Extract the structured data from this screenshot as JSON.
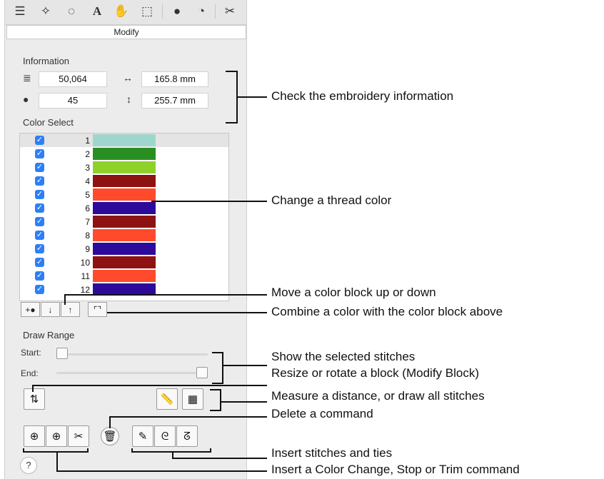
{
  "toolbar": {
    "icons": [
      "layers-icon",
      "sparkle-icon",
      "dotted-circle-icon",
      "text-icon",
      "palette-hand-icon",
      "frame-icon",
      "filled-circle-icon",
      "clock-icon",
      "scissors-icon"
    ],
    "glyphs": [
      "☰",
      "✧",
      "◌",
      "A",
      "✋",
      "⬚",
      "●",
      "◔",
      "✂"
    ]
  },
  "tab": {
    "label": "Modify"
  },
  "information": {
    "heading": "Information",
    "stitch_count": "50,064",
    "width": "165.8 mm",
    "color_count": "45",
    "height": "255.7 mm"
  },
  "color_select": {
    "heading": "Color Select",
    "rows": [
      {
        "num": "1",
        "color": "#9ed6cd"
      },
      {
        "num": "2",
        "color": "#2a8f22"
      },
      {
        "num": "3",
        "color": "#8fd12a"
      },
      {
        "num": "4",
        "color": "#8e1212"
      },
      {
        "num": "5",
        "color": "#ff4b2b"
      },
      {
        "num": "6",
        "color": "#2e0a9a"
      },
      {
        "num": "7",
        "color": "#8e1212"
      },
      {
        "num": "8",
        "color": "#ff4b2b"
      },
      {
        "num": "9",
        "color": "#2e0a9a"
      },
      {
        "num": "10",
        "color": "#8e1212"
      },
      {
        "num": "11",
        "color": "#ff4b2b"
      },
      {
        "num": "12",
        "color": "#2e0a9a"
      }
    ],
    "controls": [
      "+●",
      "↓",
      "↑",
      "⌜⌝"
    ]
  },
  "draw_range": {
    "heading": "Draw Range",
    "start_label": "Start:",
    "end_label": "End:"
  },
  "tools": {
    "rotate_glyph": "⇅",
    "ruler_glyph": "📏",
    "grid_glyph": "▦",
    "delete_glyph": "🗑",
    "insert_color_glyph": "⊕",
    "insert_stop_glyph": "⊕",
    "insert_trim_glyph": "✂",
    "insert_stitch_glyph": "✎",
    "tie_in_glyph": "ᘓ",
    "tie_out_glyph": "ᘔ",
    "help_label": "?"
  },
  "annotations": {
    "check_info": "Check the embroidery information",
    "change_thread": "Change a thread color",
    "move_block": "Move a color block up or down",
    "combine": "Combine a color with the color block above",
    "show_selected": "Show the selected stitches",
    "resize_rotate": "Resize or rotate a block (Modify Block)",
    "measure": "Measure a distance, or draw all stitches",
    "delete": "Delete a command",
    "insert_stitches": "Insert stitches and ties",
    "insert_commands": "Insert a Color Change, Stop or Trim command"
  }
}
